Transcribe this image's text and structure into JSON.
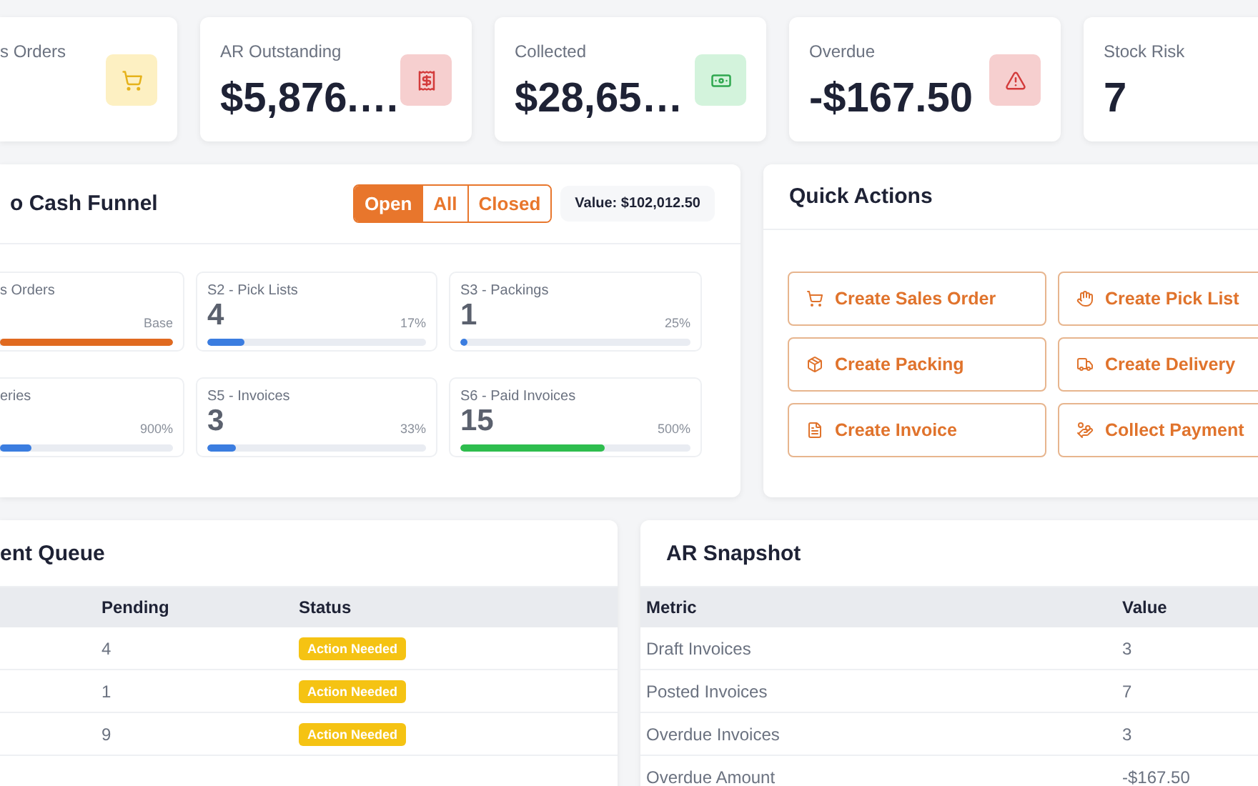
{
  "kpis": [
    {
      "label": "s Orders",
      "color": "#fdf0c2"
    },
    {
      "label": "AR Outstanding",
      "value": "$5,876.…",
      "color": "#f6cfcf"
    },
    {
      "label": "Collected",
      "value": "$28,65…",
      "color": "#d3f3dc"
    },
    {
      "label": "Overdue",
      "value": "-$167.50",
      "color": "#f6cfcf"
    },
    {
      "label": "Stock Risk",
      "value": "7"
    }
  ],
  "funnel": {
    "title": "o Cash Funnel",
    "filters": [
      {
        "label": "Open",
        "selected": true
      },
      {
        "label": "All",
        "selected": false
      },
      {
        "label": "Closed",
        "selected": false
      }
    ],
    "value": "Value: $102,012.50",
    "stages": [
      {
        "label": "s Orders",
        "pct": "Base",
        "level": 1,
        "color": "#e06a20"
      },
      {
        "label": "S2 - Pick Lists",
        "count": "4",
        "pct": "17%",
        "level": 0.17,
        "color": "#3b7de0"
      },
      {
        "label": "S3 - Packings",
        "count": "1",
        "pct": "25%",
        "level": 0.03,
        "color": "#3b7de0"
      },
      {
        "label": "eries",
        "pct": "900%",
        "level": 0.18,
        "color": "#3b7de0"
      },
      {
        "label": "S5 - Invoices",
        "count": "3",
        "pct": "33%",
        "level": 0.13,
        "color": "#3b7de0"
      },
      {
        "label": "S6 - Paid Invoices",
        "count": "15",
        "pct": "500%",
        "level": 0.63,
        "color": "#2ebd4e"
      }
    ]
  },
  "quick_actions": {
    "title": "Quick Actions",
    "buttons": [
      "Create Sales Order",
      "Create Pick List",
      "Create Packing",
      "Create Delivery",
      "Create Invoice",
      "Collect Payment"
    ]
  },
  "queue": {
    "title": "ent Queue",
    "columns": [
      "Pending",
      "Status"
    ],
    "rows": [
      {
        "pending": "4",
        "status": "Action Needed"
      },
      {
        "pending": "1",
        "status": "Action Needed"
      },
      {
        "pending": "9",
        "status": "Action Needed"
      }
    ]
  },
  "ar_snapshot": {
    "title": "AR Snapshot",
    "columns": [
      "Metric",
      "Value"
    ],
    "rows": [
      [
        "Draft Invoices",
        "3"
      ],
      [
        "Posted Invoices",
        "7"
      ],
      [
        "Overdue Invoices",
        "3"
      ],
      [
        "Overdue Amount",
        "-$167.50"
      ]
    ]
  }
}
